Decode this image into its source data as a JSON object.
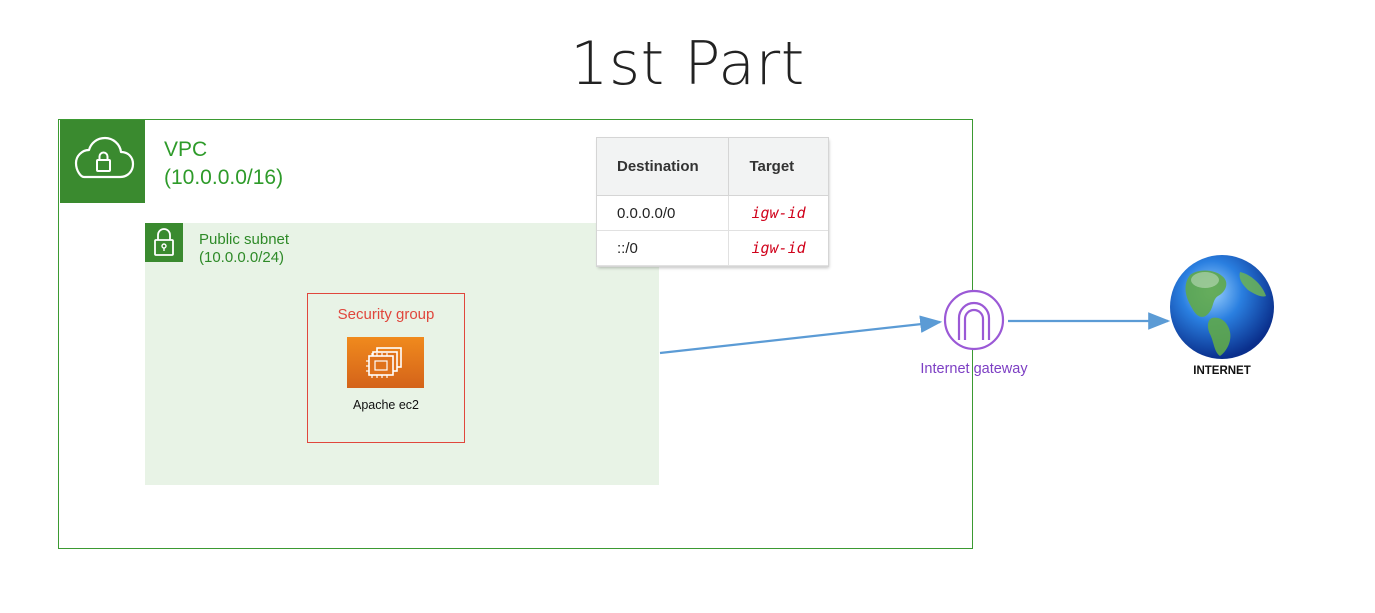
{
  "title": "1st Part",
  "vpc": {
    "name": "VPC",
    "cidr": "(10.0.0.0/16)",
    "icon": "cloud-lock-icon",
    "color": "#3b9a32"
  },
  "subnet": {
    "name": "Public subnet",
    "cidr": "(10.0.0.0/24)",
    "icon": "padlock-icon",
    "background": "#e8f3e6"
  },
  "security_group": {
    "label": "Security group",
    "color": "#e0463c"
  },
  "instance": {
    "label": "Apache ec2",
    "icon": "ec2-chip-icon",
    "color": "#f08a1d"
  },
  "route_table": {
    "headers": [
      "Destination",
      "Target"
    ],
    "rows": [
      {
        "destination": "0.0.0.0/0",
        "target": "igw-id"
      },
      {
        "destination": "::/0",
        "target": "igw-id"
      }
    ]
  },
  "internet_gateway": {
    "label": "Internet gateway",
    "icon": "internet-gateway-icon",
    "color": "#7d3fc4"
  },
  "internet": {
    "label": "INTERNET",
    "icon": "globe-icon"
  },
  "arrow_color": "#5b9bd5"
}
